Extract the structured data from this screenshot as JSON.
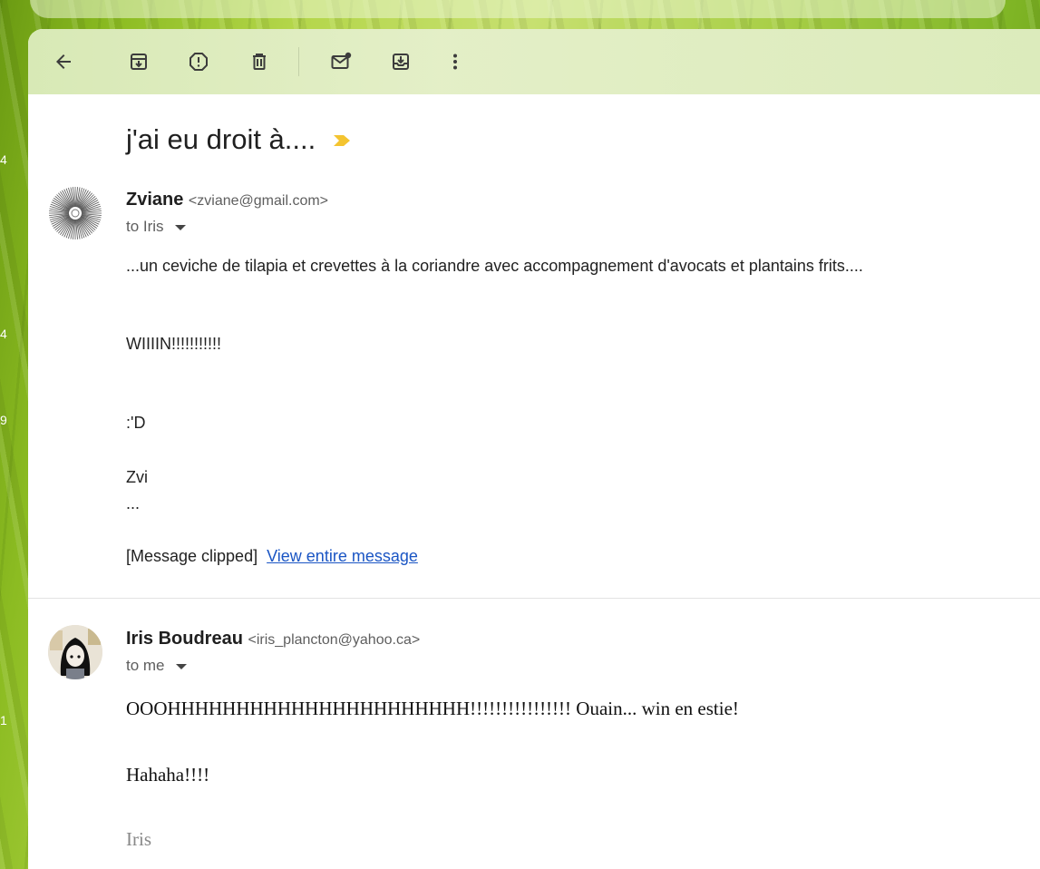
{
  "side_numbers": [
    "4",
    "4",
    "9",
    "1"
  ],
  "toolbar": {
    "back_icon": "arrow-left-icon",
    "archive_icon": "archive-icon",
    "spam_icon": "report-spam-icon",
    "delete_icon": "trash-icon",
    "mark_unread_icon": "mark-unread-icon",
    "move_icon": "move-to-inbox-icon",
    "more_icon": "more-vertical-icon"
  },
  "subject": "j'ai eu droit à....",
  "colors": {
    "importance": "#f4c430",
    "link": "#1a55c4"
  },
  "messages": [
    {
      "name": "Zviane",
      "email": "<zviane@gmail.com>",
      "to": "to Iris",
      "lines": [
        "...un ceviche de tilapia et crevettes à la coriandre avec accompagnement d'avocats et plantains frits....",
        "WIIIIN!!!!!!!!!!!",
        ":'D",
        "Zvi",
        "..."
      ],
      "clipped": "[Message clipped]",
      "view_entire": "View entire message"
    },
    {
      "name": "Iris Boudreau",
      "email": "<iris_plancton@yahoo.ca>",
      "to": "to me",
      "lines": [
        "OOOHHHHHHHHHHHHHHHHHHHHHH!!!!!!!!!!!!!!!! Ouain... win en estie!",
        "Hahaha!!!!",
        "Iris"
      ]
    }
  ]
}
